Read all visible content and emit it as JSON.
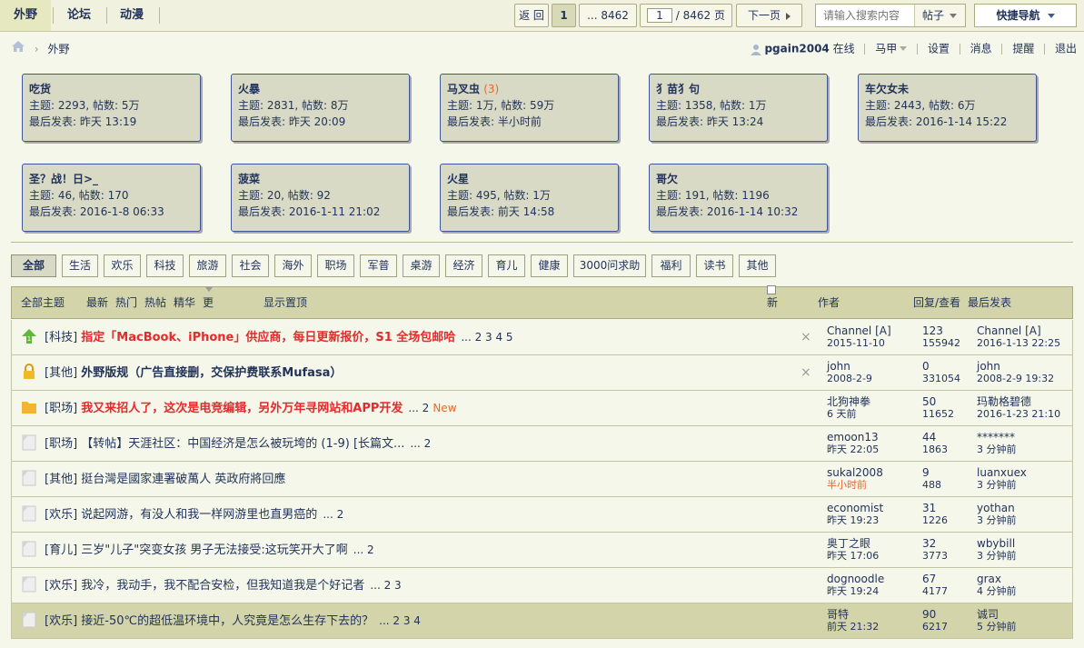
{
  "nav": {
    "tabs": [
      {
        "label": "外野",
        "active": true
      },
      {
        "label": "论坛",
        "active": false
      },
      {
        "label": "动漫",
        "active": false
      }
    ]
  },
  "pager": {
    "back_label": "返 回",
    "current": "1",
    "last_label": "... 8462",
    "page_input": "1",
    "total_label": "/ 8462 页",
    "next_label": "下一页"
  },
  "search": {
    "placeholder": "请输入搜索内容",
    "scope": "帖子"
  },
  "quick_nav_label": "快捷导航",
  "breadcrumb": {
    "current": "外野"
  },
  "userbar": {
    "username": "pgain2004",
    "status": "在线",
    "horse": "马甲",
    "settings": "设置",
    "messages": "消息",
    "reminders": "提醒",
    "logout": "退出"
  },
  "forums": [
    {
      "name": "吃货",
      "badge": "",
      "stats": "主题: 2293, 帖数: 5万",
      "last": "最后发表: 昨天 13:19"
    },
    {
      "name": "火暴",
      "badge": "",
      "stats": "主题: 2831, 帖数: 8万",
      "last": "最后发表: 昨天 20:09"
    },
    {
      "name": "马叉虫",
      "badge": "(3)",
      "stats": "主题: 1万, 帖数: 59万",
      "last": "最后发表: 半小时前"
    },
    {
      "name": "犭苗犭句",
      "badge": "",
      "stats": "主题: 1358, 帖数: 1万",
      "last": "最后发表: 昨天 13:24"
    },
    {
      "name": "车欠女未",
      "badge": "",
      "stats": "主题: 2443, 帖数: 6万",
      "last": "最后发表: 2016-1-14 15:22"
    },
    {
      "name": "圣？战！日>_",
      "badge": "",
      "stats": "主题: 46, 帖数: 170",
      "last": "最后发表: 2016-1-8 06:33"
    },
    {
      "name": "菠菜",
      "badge": "",
      "stats": "主题: 20, 帖数: 92",
      "last": "最后发表: 2016-1-11 21:02"
    },
    {
      "name": "火星",
      "badge": "",
      "stats": "主题: 495, 帖数: 1万",
      "last": "最后发表: 前天 14:58"
    },
    {
      "name": "哥欠",
      "badge": "",
      "stats": "主题: 191, 帖数: 1196",
      "last": "最后发表: 2016-1-14 10:32"
    }
  ],
  "categories": [
    "全部",
    "生活",
    "欢乐",
    "科技",
    "旅游",
    "社会",
    "海外",
    "职场",
    "军普",
    "桌游",
    "经济",
    "育儿",
    "健康",
    "3000问求助",
    "福利",
    "读书",
    "其他"
  ],
  "thead": {
    "all": "全部主题",
    "latest": "最新",
    "hot": "热门",
    "hotpost": "热帖",
    "digest": "精华",
    "more": "更多",
    "sticky": "显示置顶",
    "newwin": "新窗",
    "author": "作者",
    "replies": "回复/查看",
    "lastpost": "最后发表"
  },
  "threads": [
    {
      "icon": "up",
      "tag": "[科技]",
      "title": "指定「MacBook、iPhone」供应商，每日更新报价，S1 全场包邮哈",
      "style": "red",
      "pages": "... 2  3  4  5",
      "new": "",
      "close": true,
      "author": "Channel [A]",
      "author_time": "2015-11-10",
      "author_time_orange": false,
      "replies": "123",
      "views": "155942",
      "last_user": "Channel [A]",
      "last_time": "2016-1-13 22:25"
    },
    {
      "icon": "lock",
      "tag": "[其他]",
      "title": "外野版规（广告直接删，交保护费联系Mufasa）",
      "style": "bold",
      "pages": "",
      "new": "",
      "close": true,
      "author": "john",
      "author_time": "2008-2-9",
      "author_time_orange": false,
      "replies": "0",
      "views": "331054",
      "last_user": "john",
      "last_time": "2008-2-9 19:32"
    },
    {
      "icon": "folder",
      "tag": "[职场]",
      "title": "我又来招人了，这次是电竞编辑，另外万年寻网站和APP开发",
      "style": "red",
      "pages": "... 2",
      "new": "New",
      "close": false,
      "author": "北狗神拳",
      "author_time": "6 天前",
      "author_time_orange": false,
      "replies": "50",
      "views": "11652",
      "last_user": "玛勒格碧德",
      "last_time": "2016-1-23 21:10"
    },
    {
      "icon": "doc",
      "tag": "[职场]",
      "title": "【转帖】天涯社区：中国经济是怎么被玩垮的 (1-9) [长篇文...",
      "style": "",
      "pages": "... 2",
      "new": "",
      "close": false,
      "author": "emoon13",
      "author_time": "昨天 22:05",
      "author_time_orange": false,
      "replies": "44",
      "views": "1863",
      "last_user": "*******",
      "last_time": "3 分钟前"
    },
    {
      "icon": "doc",
      "tag": "[其他]",
      "title": "挺台灣是國家連署破萬人 英政府將回應",
      "style": "",
      "pages": "",
      "new": "",
      "close": false,
      "author": "sukal2008",
      "author_time": "半小时前",
      "author_time_orange": true,
      "replies": "9",
      "views": "488",
      "last_user": "luanxuex",
      "last_time": "3 分钟前"
    },
    {
      "icon": "doc",
      "tag": "[欢乐]",
      "title": "说起网游，有没人和我一样网游里也直男癌的",
      "style": "",
      "pages": "... 2",
      "new": "",
      "close": false,
      "author": "economist",
      "author_time": "昨天 19:23",
      "author_time_orange": false,
      "replies": "31",
      "views": "1226",
      "last_user": "yothan",
      "last_time": "3 分钟前"
    },
    {
      "icon": "doc",
      "tag": "[育儿]",
      "title": "三岁\"儿子\"突变女孩 男子无法接受:这玩笑开大了啊",
      "style": "",
      "pages": "... 2",
      "new": "",
      "close": false,
      "author": "奥丁之眼",
      "author_time": "昨天 17:06",
      "author_time_orange": false,
      "replies": "32",
      "views": "3773",
      "last_user": "wbybill",
      "last_time": "3 分钟前"
    },
    {
      "icon": "doc",
      "tag": "[欢乐]",
      "title": "我冷，我动手，我不配合安检，但我知道我是个好记者",
      "style": "",
      "pages": "... 2  3",
      "new": "",
      "close": false,
      "author": "dognoodle",
      "author_time": "昨天 19:24",
      "author_time_orange": false,
      "replies": "67",
      "views": "4177",
      "last_user": "grax",
      "last_time": "4 分钟前"
    },
    {
      "icon": "doc",
      "tag": "[欢乐]",
      "title": "接近-50℃的超低温环境中，人究竟是怎么生存下去的？",
      "style": "",
      "pages": "... 2  3  4",
      "new": "",
      "close": false,
      "author": "哥特",
      "author_time": "前天 21:32",
      "author_time_orange": false,
      "replies": "90",
      "views": "6217",
      "last_user": "诚司",
      "last_time": "5 分钟前"
    }
  ]
}
